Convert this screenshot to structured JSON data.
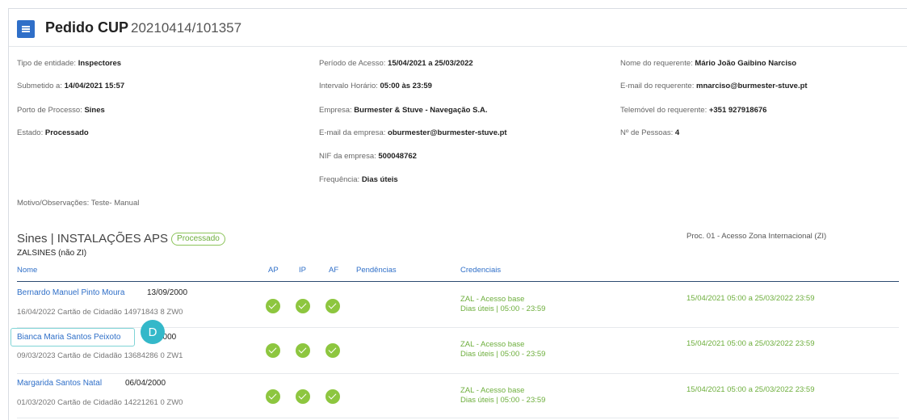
{
  "header": {
    "title": "Pedido CUP",
    "number": "20210414/101357"
  },
  "info": {
    "tipo_entidade": {
      "label": "Tipo de entidade: ",
      "value": "Inspectores"
    },
    "submetido": {
      "label": "Submetido a: ",
      "value": "14/04/2021 15:57"
    },
    "porto": {
      "label": "Porto de Processo: ",
      "value": "Sines"
    },
    "estado": {
      "label": "Estado: ",
      "value": "Processado"
    },
    "periodo": {
      "label": "Período de Acesso: ",
      "value": "15/04/2021 a 25/03/2022"
    },
    "intervalo": {
      "label": "Intervalo Horário: ",
      "value": "05:00 às 23:59"
    },
    "empresa": {
      "label": "Empresa: ",
      "value": "Burmester & Stuve - Navegação S.A."
    },
    "email_empresa": {
      "label": "E-mail da empresa: ",
      "value": "oburmester@burmester-stuve.pt"
    },
    "nif": {
      "label": "NIF da empresa: ",
      "value": "500048762"
    },
    "frequencia": {
      "label": "Frequência: ",
      "value": "Dias úteis"
    },
    "nome_req": {
      "label": "Nome do requerente: ",
      "value": "Mário João Gaibino Narciso"
    },
    "email_req": {
      "label": "E-mail do requerente: ",
      "value": "mnarciso@burmester-stuve.pt"
    },
    "telemovel": {
      "label": "Telemóvel do requerente: ",
      "value": "+351 927918676"
    },
    "pessoas": {
      "label": "Nº de Pessoas: ",
      "value": "4"
    },
    "motivo": "Motivo/Observações: Teste- Manual"
  },
  "section": {
    "title": "Sines | INSTALAÇÕES APS",
    "status": "Processado",
    "subtitle": "ZALSINES (não ZI)",
    "proc": "Proc. 01 - Acesso Zona Internacional (ZI)"
  },
  "columns": {
    "nome": "Nome",
    "ap": "AP",
    "ip": "IP",
    "af": "AF",
    "pendencias": "Pendências",
    "credenciais": "Credenciais"
  },
  "rows": [
    {
      "name": "Bernardo Manuel Pinto Moura",
      "birth": "13/09/2000",
      "doc": "16/04/2022  Cartão de Cidadão  14971843 8 ZW0",
      "cred1": "ZAL - Acesso base",
      "cred2": "Dias úteis | 05:00 - 23:59",
      "period": "15/04/2021 05:00  a  25/03/2022 23:59"
    },
    {
      "name": "Bianca Maria Santos Peixoto",
      "birth": "2000",
      "doc": "09/03/2023  Cartão de Cidadão  13684286 0 ZW1",
      "cred1": "ZAL - Acesso base",
      "cred2": "Dias úteis | 05:00 - 23:59",
      "period": "15/04/2021 05:00  a  25/03/2022 23:59"
    },
    {
      "name": "Margarida Santos Natal",
      "birth": "06/04/2000",
      "doc": "01/03/2020  Cartão de Cidadão  14221261 0 ZW0",
      "cred1": "ZAL - Acesso base",
      "cred2": "Dias úteis | 05:00 - 23:59",
      "period": "15/04/2021 05:00  a  25/03/2022 23:59"
    }
  ],
  "cursor": {
    "letter": "D"
  },
  "colors": {
    "accent": "#2f6fc8",
    "success": "#8dc63f",
    "cursor": "#34b8c9"
  },
  "icons": {
    "menu": "hamburger-icon",
    "check": "check-circle-icon"
  }
}
